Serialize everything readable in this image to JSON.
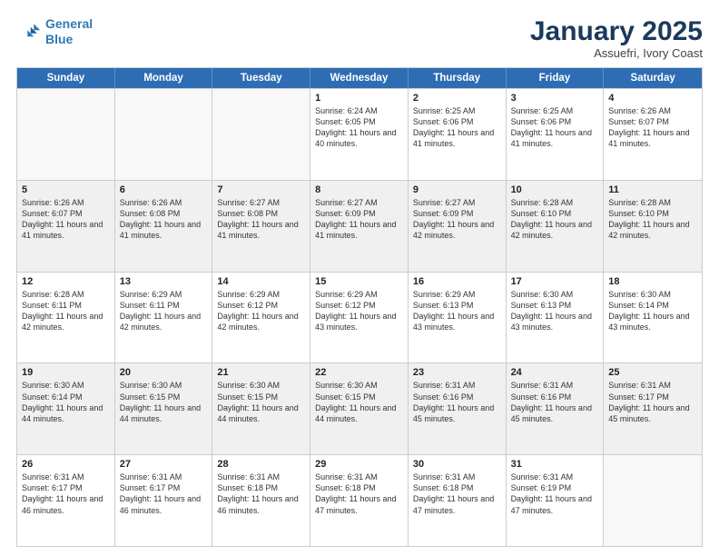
{
  "header": {
    "logo_line1": "General",
    "logo_line2": "Blue",
    "month_title": "January 2025",
    "subtitle": "Assuefri, Ivory Coast"
  },
  "weekdays": [
    "Sunday",
    "Monday",
    "Tuesday",
    "Wednesday",
    "Thursday",
    "Friday",
    "Saturday"
  ],
  "rows": [
    [
      {
        "day": "",
        "info": "",
        "empty": true
      },
      {
        "day": "",
        "info": "",
        "empty": true
      },
      {
        "day": "",
        "info": "",
        "empty": true
      },
      {
        "day": "1",
        "info": "Sunrise: 6:24 AM\nSunset: 6:05 PM\nDaylight: 11 hours and 40 minutes."
      },
      {
        "day": "2",
        "info": "Sunrise: 6:25 AM\nSunset: 6:06 PM\nDaylight: 11 hours and 41 minutes."
      },
      {
        "day": "3",
        "info": "Sunrise: 6:25 AM\nSunset: 6:06 PM\nDaylight: 11 hours and 41 minutes."
      },
      {
        "day": "4",
        "info": "Sunrise: 6:26 AM\nSunset: 6:07 PM\nDaylight: 11 hours and 41 minutes."
      }
    ],
    [
      {
        "day": "5",
        "info": "Sunrise: 6:26 AM\nSunset: 6:07 PM\nDaylight: 11 hours and 41 minutes.",
        "shaded": true
      },
      {
        "day": "6",
        "info": "Sunrise: 6:26 AM\nSunset: 6:08 PM\nDaylight: 11 hours and 41 minutes.",
        "shaded": true
      },
      {
        "day": "7",
        "info": "Sunrise: 6:27 AM\nSunset: 6:08 PM\nDaylight: 11 hours and 41 minutes.",
        "shaded": true
      },
      {
        "day": "8",
        "info": "Sunrise: 6:27 AM\nSunset: 6:09 PM\nDaylight: 11 hours and 41 minutes.",
        "shaded": true
      },
      {
        "day": "9",
        "info": "Sunrise: 6:27 AM\nSunset: 6:09 PM\nDaylight: 11 hours and 42 minutes.",
        "shaded": true
      },
      {
        "day": "10",
        "info": "Sunrise: 6:28 AM\nSunset: 6:10 PM\nDaylight: 11 hours and 42 minutes.",
        "shaded": true
      },
      {
        "day": "11",
        "info": "Sunrise: 6:28 AM\nSunset: 6:10 PM\nDaylight: 11 hours and 42 minutes.",
        "shaded": true
      }
    ],
    [
      {
        "day": "12",
        "info": "Sunrise: 6:28 AM\nSunset: 6:11 PM\nDaylight: 11 hours and 42 minutes."
      },
      {
        "day": "13",
        "info": "Sunrise: 6:29 AM\nSunset: 6:11 PM\nDaylight: 11 hours and 42 minutes."
      },
      {
        "day": "14",
        "info": "Sunrise: 6:29 AM\nSunset: 6:12 PM\nDaylight: 11 hours and 42 minutes."
      },
      {
        "day": "15",
        "info": "Sunrise: 6:29 AM\nSunset: 6:12 PM\nDaylight: 11 hours and 43 minutes."
      },
      {
        "day": "16",
        "info": "Sunrise: 6:29 AM\nSunset: 6:13 PM\nDaylight: 11 hours and 43 minutes."
      },
      {
        "day": "17",
        "info": "Sunrise: 6:30 AM\nSunset: 6:13 PM\nDaylight: 11 hours and 43 minutes."
      },
      {
        "day": "18",
        "info": "Sunrise: 6:30 AM\nSunset: 6:14 PM\nDaylight: 11 hours and 43 minutes."
      }
    ],
    [
      {
        "day": "19",
        "info": "Sunrise: 6:30 AM\nSunset: 6:14 PM\nDaylight: 11 hours and 44 minutes.",
        "shaded": true
      },
      {
        "day": "20",
        "info": "Sunrise: 6:30 AM\nSunset: 6:15 PM\nDaylight: 11 hours and 44 minutes.",
        "shaded": true
      },
      {
        "day": "21",
        "info": "Sunrise: 6:30 AM\nSunset: 6:15 PM\nDaylight: 11 hours and 44 minutes.",
        "shaded": true
      },
      {
        "day": "22",
        "info": "Sunrise: 6:30 AM\nSunset: 6:15 PM\nDaylight: 11 hours and 44 minutes.",
        "shaded": true
      },
      {
        "day": "23",
        "info": "Sunrise: 6:31 AM\nSunset: 6:16 PM\nDaylight: 11 hours and 45 minutes.",
        "shaded": true
      },
      {
        "day": "24",
        "info": "Sunrise: 6:31 AM\nSunset: 6:16 PM\nDaylight: 11 hours and 45 minutes.",
        "shaded": true
      },
      {
        "day": "25",
        "info": "Sunrise: 6:31 AM\nSunset: 6:17 PM\nDaylight: 11 hours and 45 minutes.",
        "shaded": true
      }
    ],
    [
      {
        "day": "26",
        "info": "Sunrise: 6:31 AM\nSunset: 6:17 PM\nDaylight: 11 hours and 46 minutes."
      },
      {
        "day": "27",
        "info": "Sunrise: 6:31 AM\nSunset: 6:17 PM\nDaylight: 11 hours and 46 minutes."
      },
      {
        "day": "28",
        "info": "Sunrise: 6:31 AM\nSunset: 6:18 PM\nDaylight: 11 hours and 46 minutes."
      },
      {
        "day": "29",
        "info": "Sunrise: 6:31 AM\nSunset: 6:18 PM\nDaylight: 11 hours and 47 minutes."
      },
      {
        "day": "30",
        "info": "Sunrise: 6:31 AM\nSunset: 6:18 PM\nDaylight: 11 hours and 47 minutes."
      },
      {
        "day": "31",
        "info": "Sunrise: 6:31 AM\nSunset: 6:19 PM\nDaylight: 11 hours and 47 minutes."
      },
      {
        "day": "",
        "info": "",
        "empty": true
      }
    ]
  ]
}
